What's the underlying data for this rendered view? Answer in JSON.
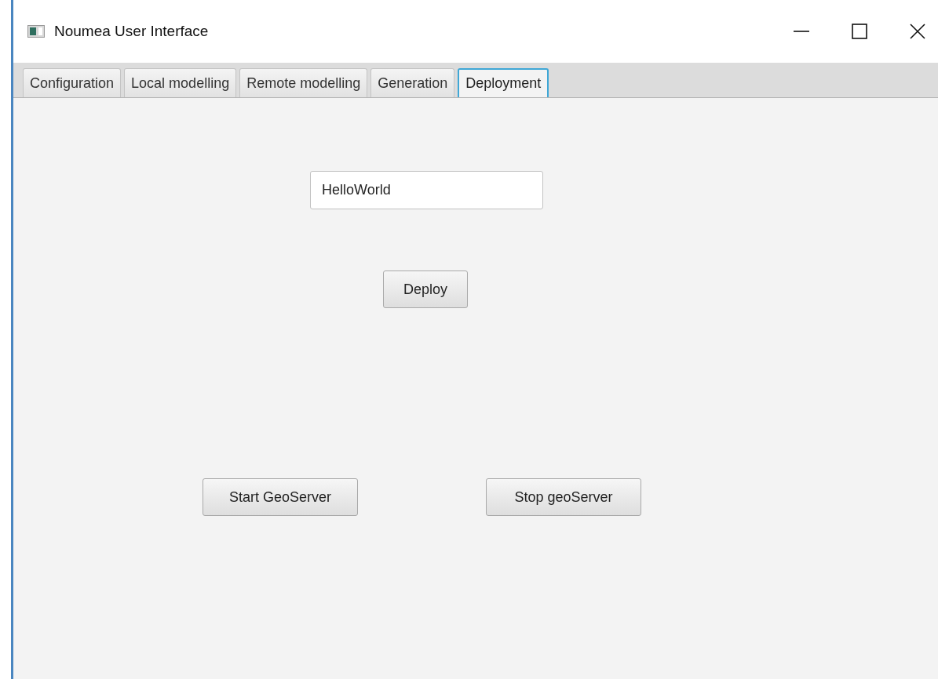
{
  "window": {
    "title": "Noumea User Interface"
  },
  "tabs": [
    {
      "label": "Configuration",
      "selected": false
    },
    {
      "label": "Local modelling",
      "selected": false
    },
    {
      "label": "Remote modelling",
      "selected": false
    },
    {
      "label": "Generation",
      "selected": false
    },
    {
      "label": "Deployment",
      "selected": true
    }
  ],
  "name_field": {
    "value": "HelloWorld"
  },
  "deploy_button": {
    "label": "Deploy"
  },
  "server_buttons": [
    {
      "label": "Start GeoServer"
    },
    {
      "label": "Stop geoServer"
    }
  ]
}
